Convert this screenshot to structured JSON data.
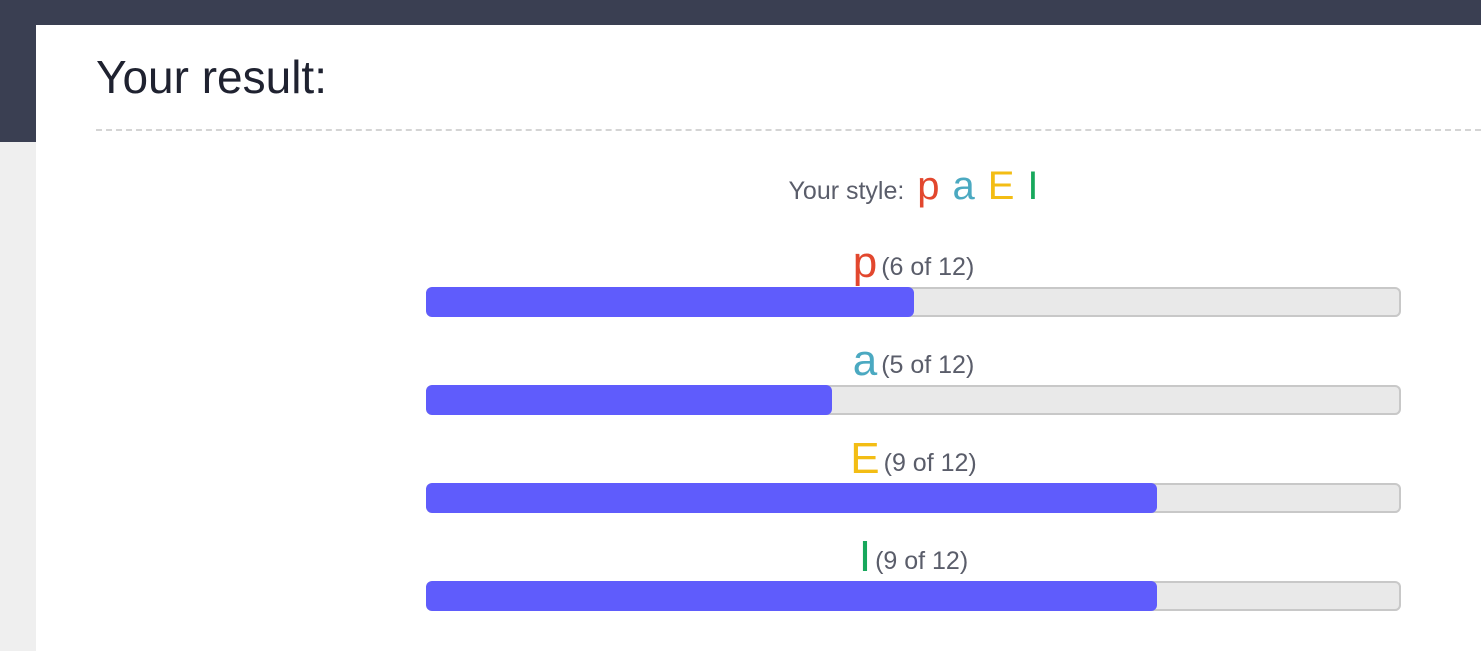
{
  "header": {
    "title": "Your result:"
  },
  "style_summary": {
    "prefix": "Your style:",
    "letters": [
      {
        "char": "p",
        "color": "#e2472e"
      },
      {
        "char": "a",
        "color": "#4ba9c1"
      },
      {
        "char": "E",
        "color": "#f3bd14"
      },
      {
        "char": "I",
        "color": "#17a85c"
      }
    ]
  },
  "metrics": [
    {
      "letter": "p",
      "color": "#e2472e",
      "count": "(6 of 12)",
      "value": 6,
      "max": 12
    },
    {
      "letter": "a",
      "color": "#4ba9c1",
      "count": "(5 of 12)",
      "value": 5,
      "max": 12
    },
    {
      "letter": "E",
      "color": "#f3bd14",
      "count": "(9 of 12)",
      "value": 9,
      "max": 12
    },
    {
      "letter": "I",
      "color": "#17a85c",
      "count": "(9 of 12)",
      "value": 9,
      "max": 12
    }
  ],
  "colors": {
    "bar_fill": "#5f5cfc",
    "bar_track": "#e9e9e9",
    "topbar": "#3a3f52"
  }
}
